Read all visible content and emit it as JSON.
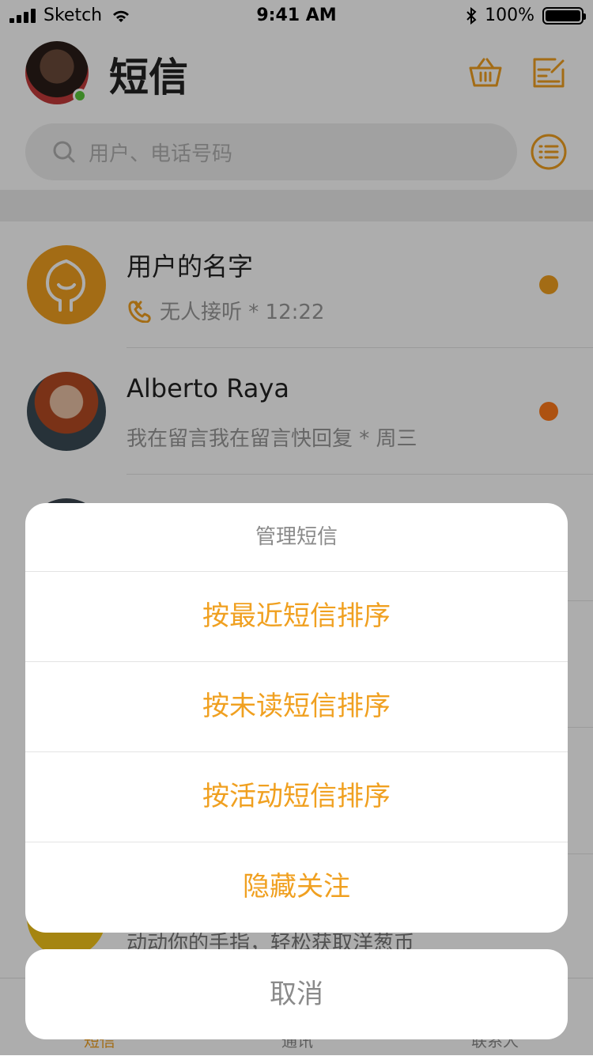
{
  "status_bar": {
    "carrier": "Sketch",
    "time": "9:41 AM",
    "battery": "100%"
  },
  "header": {
    "title": "短信"
  },
  "search": {
    "placeholder": "用户、电话号码"
  },
  "list": {
    "items": [
      {
        "name": "用户的名字",
        "subtitle": "无人接听 * 12:22",
        "dot_color": "#f0a020"
      },
      {
        "name": "Alberto Raya",
        "subtitle": "我在留言我在留言快回复 * 周三",
        "dot_color": "#ff7a1a"
      },
      {
        "name": "",
        "subtitle": "动动你的手指，轻松获取洋葱币",
        "dot_color": ""
      }
    ]
  },
  "tabbar": {
    "tabs": [
      "短信",
      "通讯",
      "联系人"
    ]
  },
  "action_sheet": {
    "title": "管理短信",
    "items": [
      "按最近短信排序",
      "按未读短信排序",
      "按活动短信排序",
      "隐藏关注"
    ],
    "cancel": "取消"
  },
  "colors": {
    "accent": "#f0a020",
    "dim": "rgba(0,0,0,0.32)"
  }
}
